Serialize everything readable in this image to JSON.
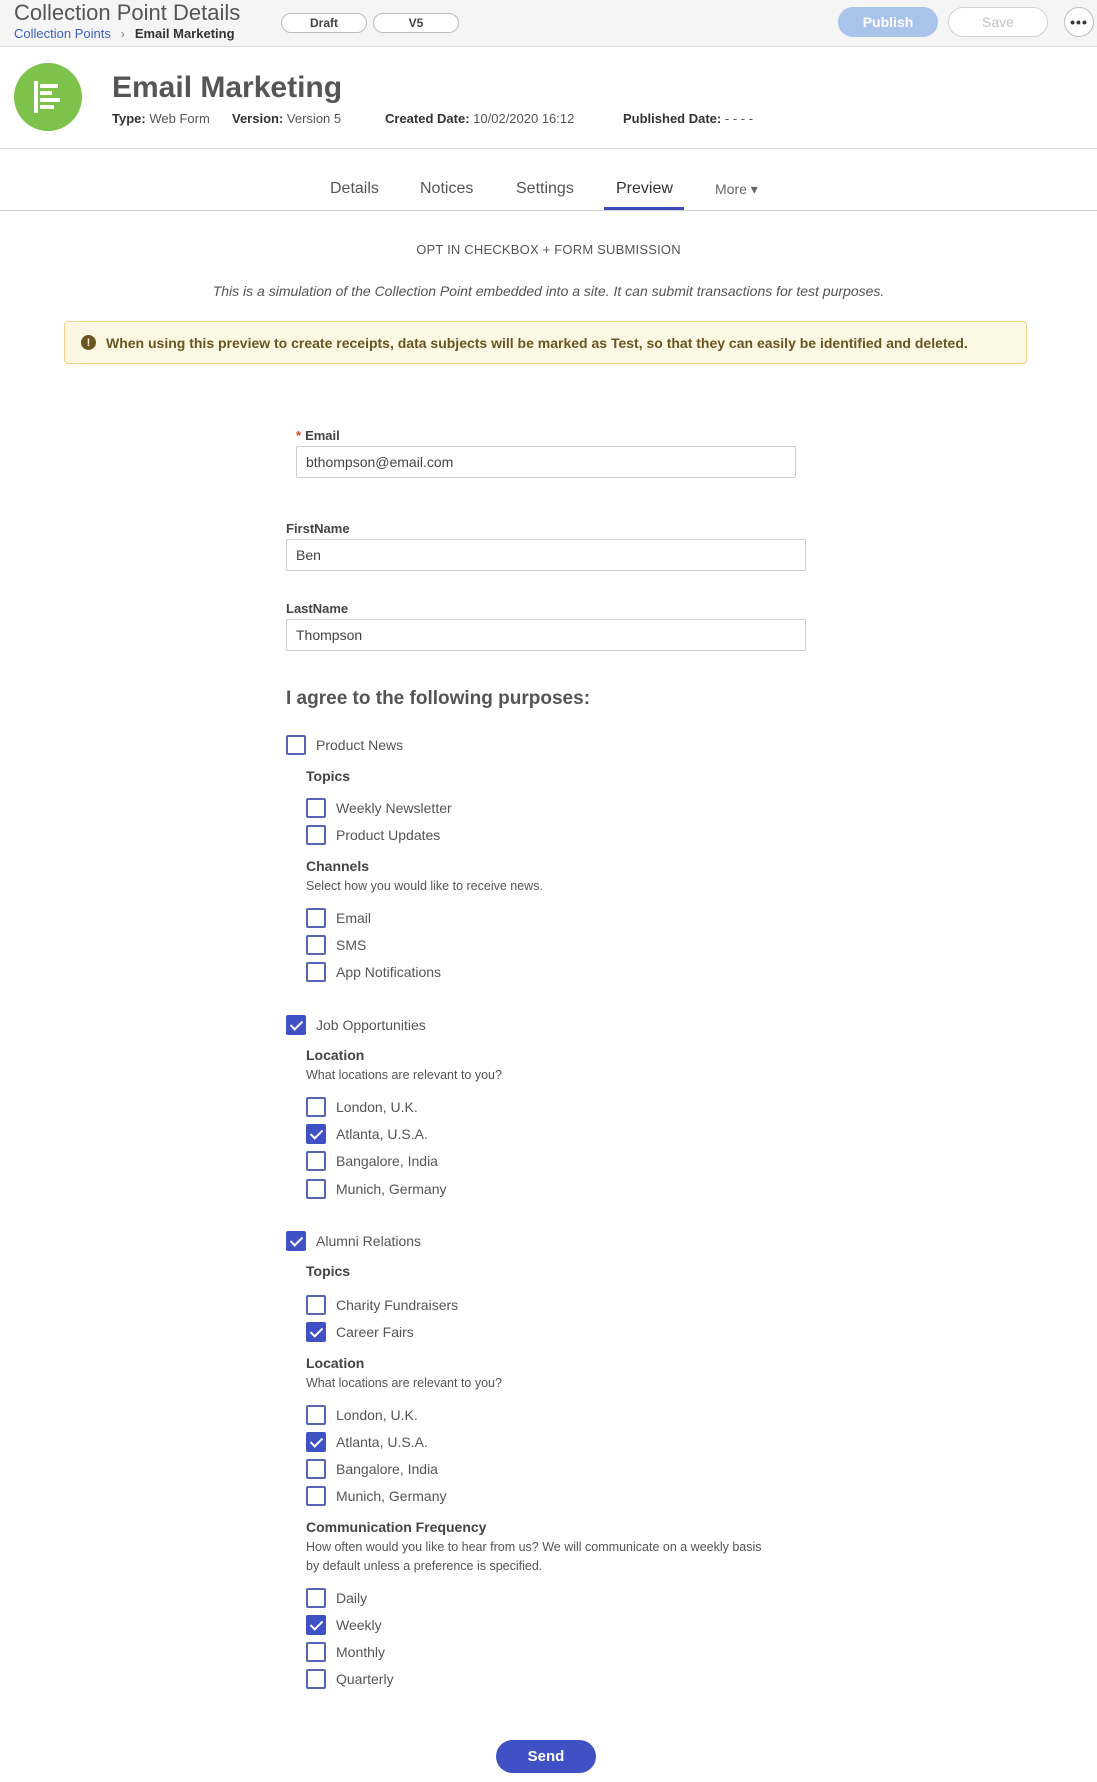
{
  "topbar": {
    "title": "Collection Point Details",
    "breadcrumb": {
      "parent": "Collection Points",
      "separator": "›",
      "current": "Email Marketing"
    },
    "status_pill": "Draft",
    "version_pill": "V5",
    "publish_label": "Publish",
    "save_label": "Save",
    "more_label": "•••"
  },
  "header": {
    "title": "Email Marketing",
    "type_label": "Type:",
    "type_value": "Web Form",
    "version_label": "Version:",
    "version_value": "Version 5",
    "created_label": "Created Date:",
    "created_value": "10/02/2020 16:12",
    "published_label": "Published Date:",
    "published_value": "- - - -",
    "logo_icon": "list-icon",
    "logo_color": "#7dc24b"
  },
  "tabs": {
    "details": "Details",
    "notices": "Notices",
    "settings": "Settings",
    "preview": "Preview",
    "more": "More",
    "more_caret": "▾",
    "active": "Preview"
  },
  "preview": {
    "section_title": "OPT IN CHECKBOX + FORM SUBMISSION",
    "simulation_text": "This is a simulation of the Collection Point embedded into a site. It can submit transactions for test purposes.",
    "warning_icon": "!",
    "warning_text": "When using this preview to create receipts, data subjects will be marked as Test, so that they can easily be identified and deleted."
  },
  "form": {
    "email_required": "*",
    "email_label": "Email",
    "email_value": "bthompson@email.com",
    "firstname_label": "FirstName",
    "firstname_value": "Ben",
    "lastname_label": "LastName",
    "lastname_value": "Thompson",
    "purposes_heading": "I agree to the following purposes:",
    "purposes": {
      "product_news": {
        "label": "Product News",
        "checked": false,
        "topics_heading": "Topics",
        "topics": [
          "Weekly Newsletter",
          "Product Updates"
        ],
        "channels_heading": "Channels",
        "channels_desc": "Select how you would like to receive news.",
        "channels": [
          "Email",
          "SMS",
          "App Notifications"
        ]
      },
      "job_opportunities": {
        "label": "Job Opportunities",
        "checked": true,
        "location_heading": "Location",
        "location_desc": "What locations are relevant to you?",
        "locations": [
          "London, U.K.",
          "Atlanta, U.S.A.",
          "Bangalore, India",
          "Munich, Germany"
        ],
        "locations_checked": [
          false,
          true,
          false,
          false
        ]
      },
      "alumni_relations": {
        "label": "Alumni Relations",
        "checked": true,
        "topics_heading": "Topics",
        "topics": [
          "Charity Fundraisers",
          "Career Fairs"
        ],
        "topics_checked": [
          false,
          true
        ],
        "location_heading": "Location",
        "location_desc": "What locations are relevant to you?",
        "locations": [
          "London, U.K.",
          "Atlanta, U.S.A.",
          "Bangalore, India",
          "Munich, Germany"
        ],
        "locations_checked": [
          false,
          true,
          false,
          false
        ],
        "frequency_heading": "Communication Frequency",
        "frequency_desc_1": "How often would you like to hear from us? We will communicate on a weekly basis",
        "frequency_desc_2": "by default unless a preference is specified.",
        "frequency": [
          "Daily",
          "Weekly",
          "Monthly",
          "Quarterly"
        ],
        "frequency_checked": [
          false,
          true,
          false,
          false
        ]
      }
    },
    "send_label": "Send"
  },
  "colors": {
    "accent": "#3f51c4",
    "link": "#3b5fc0",
    "publish_disabled": "#a9c3ea",
    "warning_bg": "#fdf8e4",
    "warning_border": "#f1d38a",
    "warning_text": "#6b5420"
  }
}
